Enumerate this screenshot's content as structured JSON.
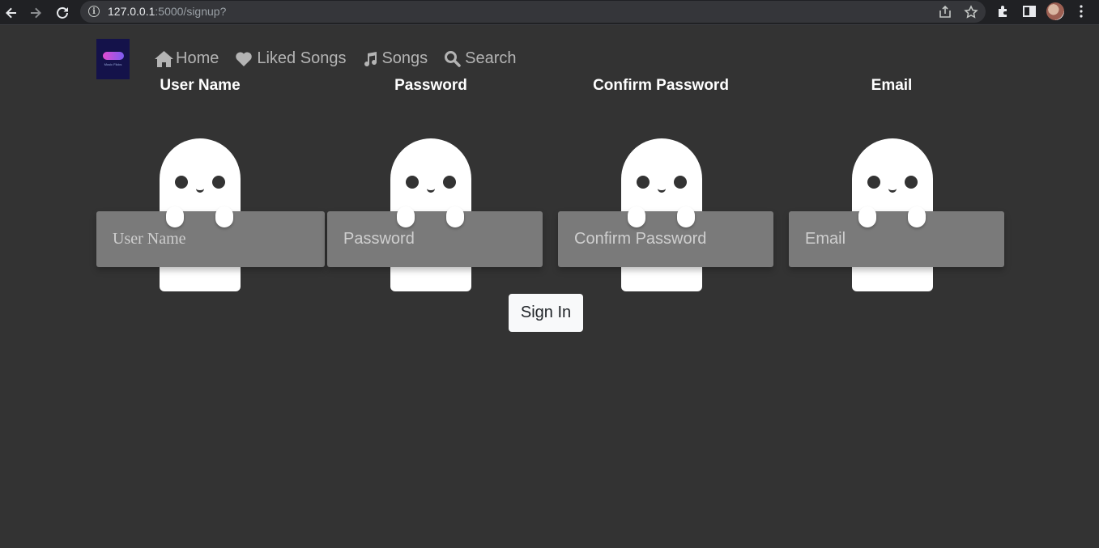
{
  "browser": {
    "url_host": "127.0.0.1",
    "url_rest": ":5000/signup?"
  },
  "logo": {
    "text": "Music Flicks"
  },
  "nav": {
    "home": "Home",
    "liked": "Liked Songs",
    "songs": "Songs",
    "search": "Search"
  },
  "form": {
    "username": {
      "label": "User Name",
      "placeholder": "User Name"
    },
    "password": {
      "label": "Password",
      "placeholder": "Password"
    },
    "confirm": {
      "label": "Confirm Password",
      "placeholder": "Confirm Password"
    },
    "email": {
      "label": "Email",
      "placeholder": "Email"
    },
    "submit": "Sign In"
  }
}
